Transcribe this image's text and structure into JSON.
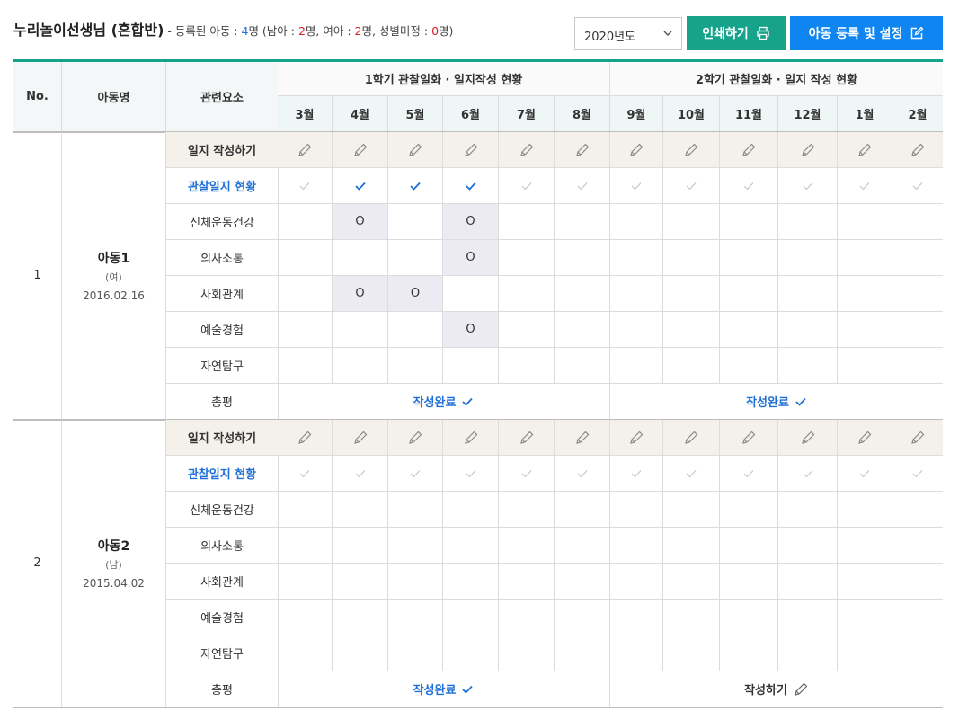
{
  "header": {
    "teacher_name": "누리놀이선생님 (혼합반)",
    "prefix": " - 등록된 아동 : ",
    "total": "4",
    "part2": "명 (남아 : ",
    "boys": "2",
    "part3": "명, 여아 : ",
    "girls": "2",
    "part4": "명, 성별미정 : ",
    "undetermined": "0",
    "part5": "명)"
  },
  "year_select": {
    "value": "2020년도",
    "icon": "chevron-down-icon"
  },
  "buttons": {
    "print_label": "인쇄하기",
    "print_icon": "printer-icon",
    "register_label": "아동 등록 및 설정",
    "register_icon": "edit-icon"
  },
  "table": {
    "col_no": "No.",
    "col_child": "아동명",
    "col_element": "관련요소",
    "semester1": "1학기 관찰일화 · 일지작성 현황",
    "semester2": "2학기 관찰일화 · 일지 작성 현황",
    "months": [
      "3월",
      "4월",
      "5월",
      "6월",
      "7월",
      "8월",
      "9월",
      "10월",
      "11월",
      "12월",
      "1월",
      "2월"
    ],
    "row_labels": {
      "write": "일지 작성하기",
      "status": "관찰일지 현황",
      "areas": [
        "신체운동건강",
        "의사소통",
        "사회관계",
        "예술경험",
        "자연탐구"
      ],
      "summary": "총평"
    },
    "children": [
      {
        "no": "1",
        "name": "아동1",
        "gender": "(여)",
        "dob": "2016.02.16",
        "status_checked": [
          false,
          true,
          true,
          true,
          false,
          false,
          false,
          false,
          false,
          false,
          false,
          false
        ],
        "marks": [
          [
            "",
            "O",
            "",
            "O",
            "",
            "",
            "",
            "",
            "",
            "",
            "",
            ""
          ],
          [
            "",
            "",
            "",
            "O",
            "",
            "",
            "",
            "",
            "",
            "",
            "",
            ""
          ],
          [
            "",
            "O",
            "O",
            "",
            "",
            "",
            "",
            "",
            "",
            "",
            "",
            ""
          ],
          [
            "",
            "",
            "",
            "O",
            "",
            "",
            "",
            "",
            "",
            "",
            "",
            ""
          ],
          [
            "",
            "",
            "",
            "",
            "",
            "",
            "",
            "",
            "",
            "",
            "",
            ""
          ]
        ],
        "summary1": "작성완료",
        "summary1_state": "done",
        "summary2": "작성완료",
        "summary2_state": "done"
      },
      {
        "no": "2",
        "name": "아동2",
        "gender": "(남)",
        "dob": "2015.04.02",
        "status_checked": [
          false,
          false,
          false,
          false,
          false,
          false,
          false,
          false,
          false,
          false,
          false,
          false
        ],
        "marks": [
          [
            "",
            "",
            "",
            "",
            "",
            "",
            "",
            "",
            "",
            "",
            "",
            ""
          ],
          [
            "",
            "",
            "",
            "",
            "",
            "",
            "",
            "",
            "",
            "",
            "",
            ""
          ],
          [
            "",
            "",
            "",
            "",
            "",
            "",
            "",
            "",
            "",
            "",
            "",
            ""
          ],
          [
            "",
            "",
            "",
            "",
            "",
            "",
            "",
            "",
            "",
            "",
            "",
            ""
          ],
          [
            "",
            "",
            "",
            "",
            "",
            "",
            "",
            "",
            "",
            "",
            "",
            ""
          ]
        ],
        "summary1": "작성완료",
        "summary1_state": "done",
        "summary2": "작성하기",
        "summary2_state": "write"
      }
    ]
  },
  "colors": {
    "accent_green": "#17a38b",
    "accent_blue": "#0f85f2",
    "status_blue": "#1f6fd6",
    "mark_bg": "#eceaf3",
    "write_row_bg": "#f3f1ea"
  }
}
